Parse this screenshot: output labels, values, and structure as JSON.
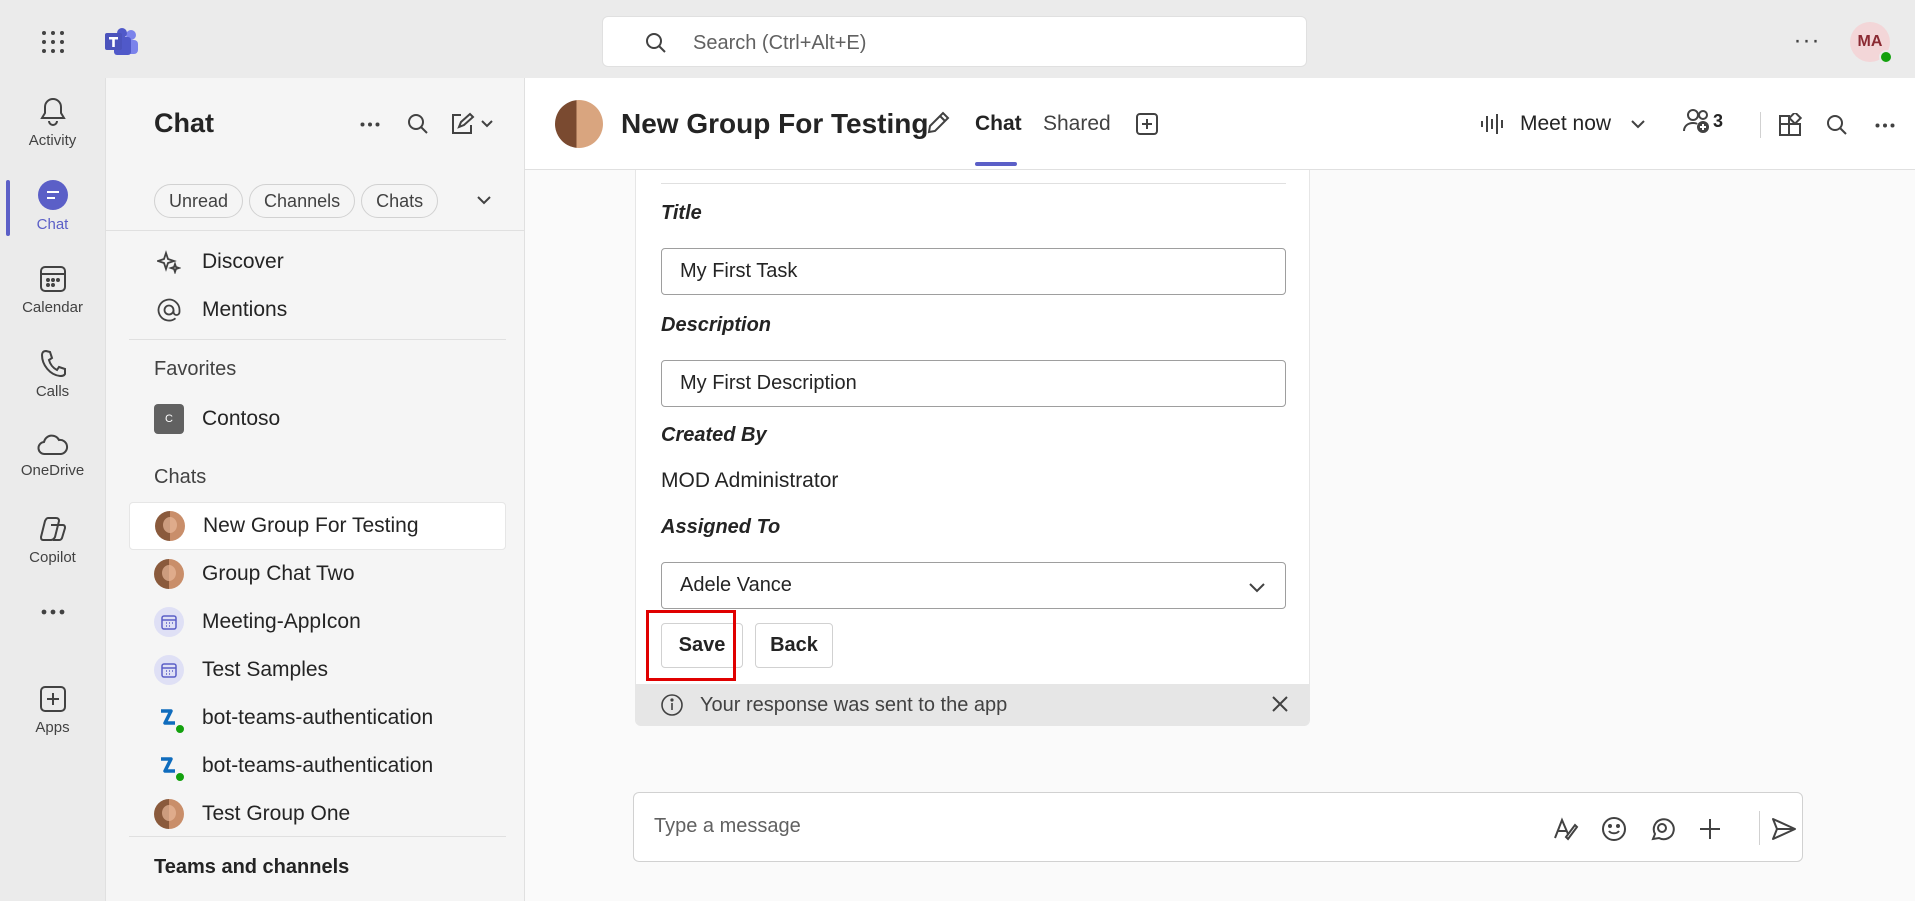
{
  "titlebar": {
    "search_placeholder": "Search (Ctrl+Alt+E)",
    "more_label": "···",
    "user_initials": "MA",
    "presence": "available"
  },
  "rail": {
    "items": [
      {
        "label": "Activity",
        "icon": "bell-icon"
      },
      {
        "label": "Chat",
        "icon": "chat-icon",
        "active": true
      },
      {
        "label": "Calendar",
        "icon": "calendar-icon"
      },
      {
        "label": "Calls",
        "icon": "phone-icon"
      },
      {
        "label": "OneDrive",
        "icon": "cloud-icon"
      },
      {
        "label": "Copilot",
        "icon": "copilot-icon"
      },
      {
        "label": "",
        "icon": "more-icon"
      },
      {
        "label": "Apps",
        "icon": "add-app-icon"
      }
    ]
  },
  "chatlist": {
    "title": "Chat",
    "filters": [
      "Unread",
      "Channels",
      "Chats"
    ],
    "nav": [
      {
        "label": "Discover",
        "icon": "sparkle-icon"
      },
      {
        "label": "Mentions",
        "icon": "at-icon"
      }
    ],
    "favorites_label": "Favorites",
    "favorites": [
      {
        "label": "Contoso",
        "initial": "C"
      }
    ],
    "chats_label": "Chats",
    "chats": [
      {
        "label": "New Group For Testing",
        "type": "photo",
        "active": true
      },
      {
        "label": "Group Chat Two",
        "type": "photo"
      },
      {
        "label": "Meeting-AppIcon",
        "type": "app"
      },
      {
        "label": "Test Samples",
        "type": "app"
      },
      {
        "label": "bot-teams-authentication",
        "type": "bot"
      },
      {
        "label": "bot-teams-authentication",
        "type": "bot"
      },
      {
        "label": "Test Group One",
        "type": "photo"
      }
    ],
    "teams_label": "Teams and channels"
  },
  "header": {
    "title": "New Group For Testing",
    "tabs": [
      "Chat",
      "Shared"
    ],
    "meet_now": "Meet now",
    "participant_count": "3"
  },
  "card": {
    "title_label": "Title",
    "title_value": "My First Task",
    "description_label": "Description",
    "description_value": "My First Description",
    "created_by_label": "Created By",
    "created_by_value": "MOD Administrator",
    "assigned_to_label": "Assigned To",
    "assigned_to_value": "Adele Vance",
    "save_label": "Save",
    "back_label": "Back",
    "response_text": "Your response was sent to the app"
  },
  "composer": {
    "placeholder": "Type a message"
  },
  "colors": {
    "accent": "#5b5fc7",
    "highlight": "#e00000",
    "presence": "#13a10e"
  }
}
